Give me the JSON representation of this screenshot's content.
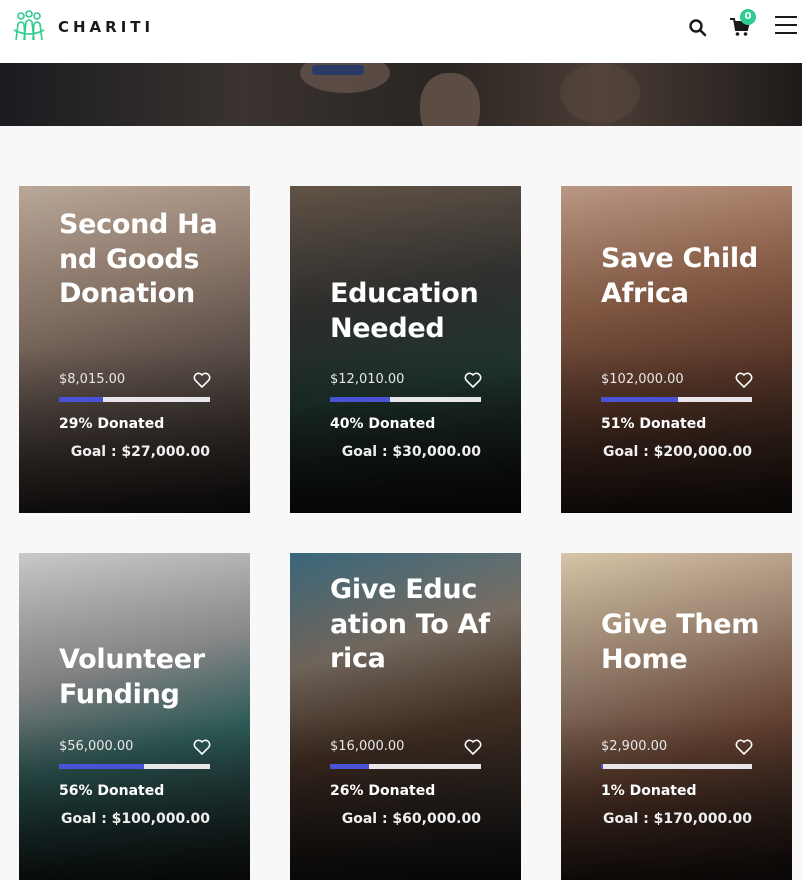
{
  "header": {
    "logo_text": "CHARITI",
    "cart_count": "0"
  },
  "colors": {
    "accent": "#4a52d6",
    "badge": "#2ecc8f",
    "logo": "#2ecc8f"
  },
  "icons": [
    "logo-icon",
    "search-icon",
    "cart-icon",
    "menu-icon",
    "heart-icon"
  ],
  "cards": [
    {
      "title": "Second Hand Goods Donation",
      "raised": "$8,015.00",
      "progress": 0.29,
      "percent_label": "29% Donated",
      "goal": "Goal : $27,000.00"
    },
    {
      "title": "Education Needed",
      "raised": "$12,010.00",
      "progress": 0.4,
      "percent_label": "40% Donated",
      "goal": "Goal : $30,000.00"
    },
    {
      "title": "Save Child Africa",
      "raised": "$102,000.00",
      "progress": 0.51,
      "percent_label": "51% Donated",
      "goal": "Goal : $200,000.00"
    },
    {
      "title": "Volunteer Funding",
      "raised": "$56,000.00",
      "progress": 0.56,
      "percent_label": "56% Donated",
      "goal": "Goal : $100,000.00"
    },
    {
      "title": "Give Education To Africa",
      "raised": "$16,000.00",
      "progress": 0.26,
      "percent_label": "26% Donated",
      "goal": "Goal : $60,000.00"
    },
    {
      "title": "Give Them Home",
      "raised": "$2,900.00",
      "progress": 0.01,
      "percent_label": "1% Donated",
      "goal": "Goal : $170,000.00"
    }
  ]
}
